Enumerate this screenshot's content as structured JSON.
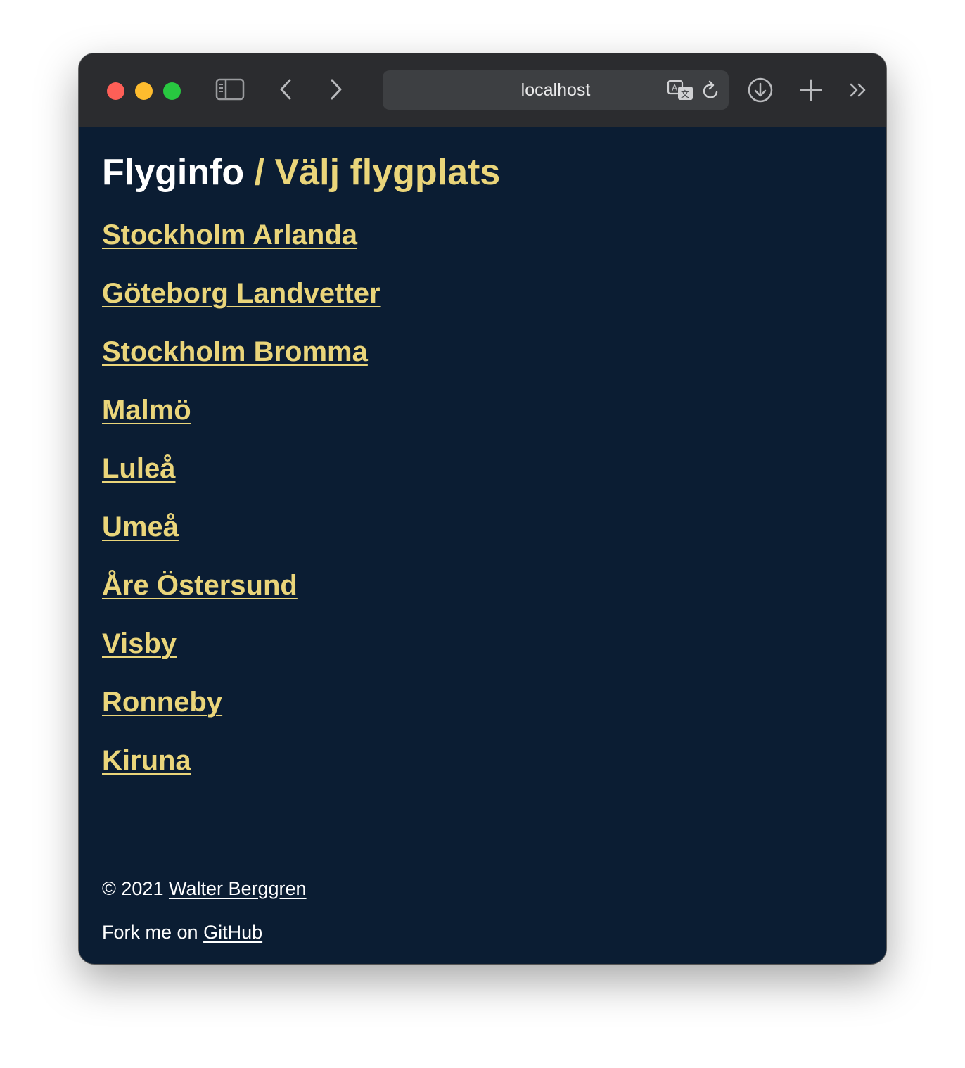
{
  "browser": {
    "address": "localhost"
  },
  "page": {
    "title_main": "Flyginfo",
    "title_sub": "/ Välj flygplats"
  },
  "airports": [
    "Stockholm Arlanda",
    "Göteborg Landvetter",
    "Stockholm Bromma",
    "Malmö",
    "Luleå",
    "Umeå",
    "Åre Östersund",
    "Visby",
    "Ronneby",
    "Kiruna"
  ],
  "footer": {
    "copyright_prefix": "© 2021",
    "author": "Walter Berggren",
    "fork_prefix": "Fork me on",
    "github": "GitHub"
  },
  "colors": {
    "page_background": "#0b1d33",
    "accent": "#ead57a",
    "toolbar": "#2b2c2f"
  }
}
